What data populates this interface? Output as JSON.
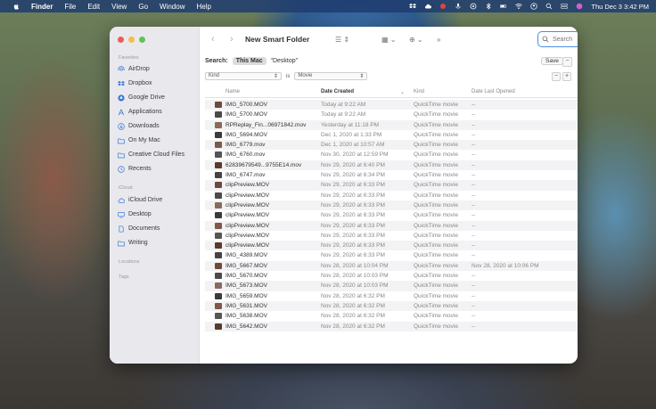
{
  "menubar": {
    "menus": [
      "Finder",
      "File",
      "Edit",
      "View",
      "Go",
      "Window",
      "Help"
    ],
    "datetime": "Thu Dec 3  3:42 PM"
  },
  "window": {
    "title": "New Smart Folder",
    "search_placeholder": "Search"
  },
  "sidebar": {
    "favorites_label": "Favorites",
    "icloud_label": "iCloud",
    "locations_label": "Locations",
    "tags_label": "Tags",
    "favorites": [
      {
        "label": "AirDrop",
        "icon": "airdrop-icon"
      },
      {
        "label": "Dropbox",
        "icon": "dropbox-icon"
      },
      {
        "label": "Google Drive",
        "icon": "google-drive-icon"
      },
      {
        "label": "Applications",
        "icon": "applications-icon"
      },
      {
        "label": "Downloads",
        "icon": "downloads-icon"
      },
      {
        "label": "On My Mac",
        "icon": "folder-icon"
      },
      {
        "label": "Creative Cloud Files",
        "icon": "folder-icon"
      },
      {
        "label": "Recents",
        "icon": "clock-icon"
      }
    ],
    "icloud": [
      {
        "label": "iCloud Drive",
        "icon": "cloud-icon"
      },
      {
        "label": "Desktop",
        "icon": "desktop-icon"
      },
      {
        "label": "Documents",
        "icon": "document-icon"
      },
      {
        "label": "Writing",
        "icon": "folder-icon"
      }
    ]
  },
  "scopebar": {
    "label": "Search:",
    "this_mac": "This Mac",
    "desktop": "“Desktop”",
    "save": "Save",
    "minus": "−"
  },
  "rule": {
    "attribute": "Kind",
    "operator": "is",
    "value": "Movie",
    "minus": "−",
    "plus": "+"
  },
  "columns": {
    "name": "Name",
    "date_created": "Date Created",
    "kind": "Kind",
    "date_last_opened": "Date Last Opened"
  },
  "files": [
    {
      "name": "IMG_5700.MOV",
      "created": "Today at 9:22 AM",
      "kind": "QuickTime movie",
      "opened": "--"
    },
    {
      "name": "IMG_5700.MOV",
      "created": "Today at 9:22 AM",
      "kind": "QuickTime movie",
      "opened": "--"
    },
    {
      "name": "RPReplay_Fin...06971842.mov",
      "created": "Yesterday at 11:18 PM",
      "kind": "QuickTime movie",
      "opened": "--"
    },
    {
      "name": "IMG_5694.MOV",
      "created": "Dec 1, 2020 at 1:33 PM",
      "kind": "QuickTime movie",
      "opened": "--"
    },
    {
      "name": "IMG_6779.mov",
      "created": "Dec 1, 2020 at 10:57 AM",
      "kind": "QuickTime movie",
      "opened": "--"
    },
    {
      "name": "IMG_6760.mov",
      "created": "Nov 30, 2020 at 12:59 PM",
      "kind": "QuickTime movie",
      "opened": "--"
    },
    {
      "name": "62839679549...9755E14.mov",
      "created": "Nov 29, 2020 at 6:40 PM",
      "kind": "QuickTime movie",
      "opened": "--"
    },
    {
      "name": "IMG_6747.mov",
      "created": "Nov 29, 2020 at 6:34 PM",
      "kind": "QuickTime movie",
      "opened": "--"
    },
    {
      "name": "clipPreview.MOV",
      "created": "Nov 29, 2020 at 6:33 PM",
      "kind": "QuickTime movie",
      "opened": "--"
    },
    {
      "name": "clipPreview.MOV",
      "created": "Nov 29, 2020 at 6:33 PM",
      "kind": "QuickTime movie",
      "opened": "--"
    },
    {
      "name": "clipPreview.MOV",
      "created": "Nov 29, 2020 at 6:33 PM",
      "kind": "QuickTime movie",
      "opened": "--"
    },
    {
      "name": "clipPreview.MOV",
      "created": "Nov 29, 2020 at 6:33 PM",
      "kind": "QuickTime movie",
      "opened": "--"
    },
    {
      "name": "clipPreview.MOV",
      "created": "Nov 29, 2020 at 6:33 PM",
      "kind": "QuickTime movie",
      "opened": "--"
    },
    {
      "name": "clipPreview.MOV",
      "created": "Nov 29, 2020 at 6:33 PM",
      "kind": "QuickTime movie",
      "opened": "--"
    },
    {
      "name": "clipPreview.MOV",
      "created": "Nov 29, 2020 at 6:33 PM",
      "kind": "QuickTime movie",
      "opened": "--"
    },
    {
      "name": "IMG_4389.MOV",
      "created": "Nov 29, 2020 at 6:33 PM",
      "kind": "QuickTime movie",
      "opened": "--"
    },
    {
      "name": "IMG_5667.MOV",
      "created": "Nov 28, 2020 at 10:04 PM",
      "kind": "QuickTime movie",
      "opened": "Nov 28, 2020 at 10:06 PM"
    },
    {
      "name": "IMG_5670.MOV",
      "created": "Nov 28, 2020 at 10:03 PM",
      "kind": "QuickTime movie",
      "opened": "--"
    },
    {
      "name": "IMG_5673.MOV",
      "created": "Nov 28, 2020 at 10:03 PM",
      "kind": "QuickTime movie",
      "opened": "--"
    },
    {
      "name": "IMG_5659.MOV",
      "created": "Nov 28, 2020 at 6:32 PM",
      "kind": "QuickTime movie",
      "opened": "--"
    },
    {
      "name": "IMG_5631.MOV",
      "created": "Nov 28, 2020 at 6:32 PM",
      "kind": "QuickTime movie",
      "opened": "--"
    },
    {
      "name": "IMG_5638.MOV",
      "created": "Nov 28, 2020 at 6:32 PM",
      "kind": "QuickTime movie",
      "opened": "--"
    },
    {
      "name": "IMG_5642.MOV",
      "created": "Nov 28, 2020 at 6:32 PM",
      "kind": "QuickTime movie",
      "opened": "--"
    }
  ]
}
